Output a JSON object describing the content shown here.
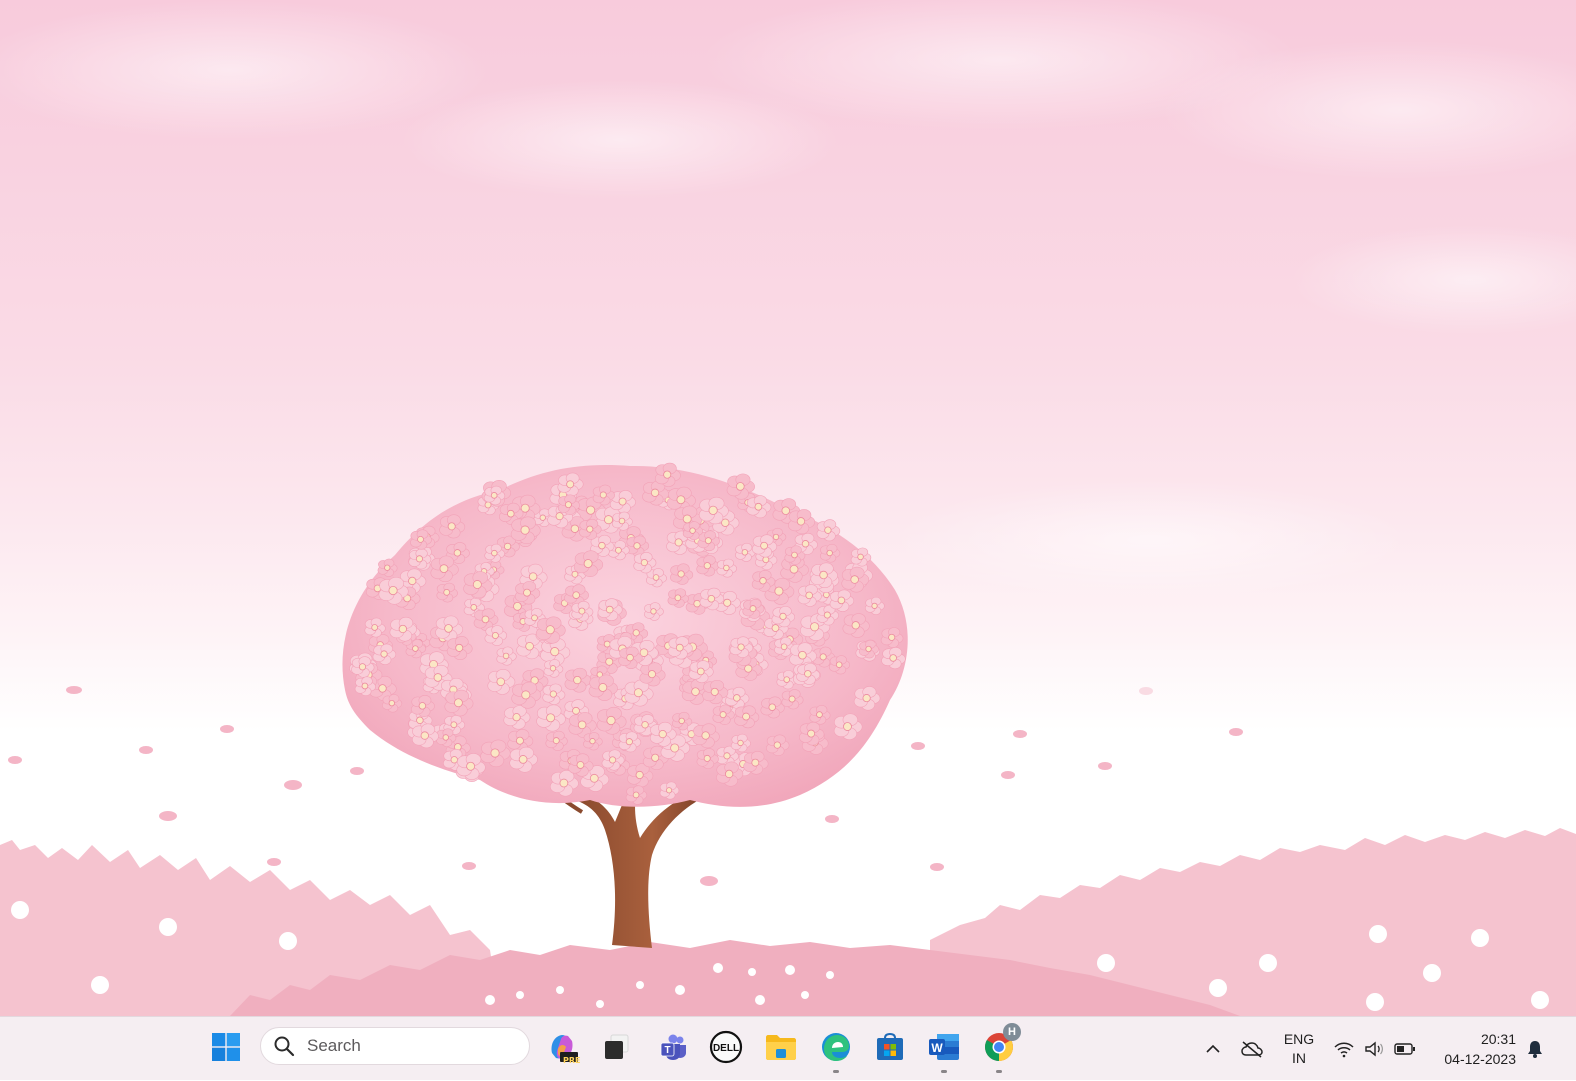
{
  "desktop": {
    "wallpaper": "cherry-blossom-tree",
    "colors": {
      "sky": "#f8cbdc",
      "hills": "#f4b8c6",
      "blossom": "#f6b3c6",
      "trunk": "#9a5536"
    }
  },
  "taskbar": {
    "background": "#f5eef2",
    "start_icon": "windows-logo-icon",
    "search": {
      "placeholder": "Search",
      "icon": "search-icon"
    },
    "apps": [
      {
        "name": "copilot-preview",
        "icon": "copilot-icon",
        "badge": "PRE",
        "running": false
      },
      {
        "name": "task-view",
        "icon": "task-view-icon",
        "running": false
      },
      {
        "name": "teams",
        "icon": "teams-icon",
        "running": false
      },
      {
        "name": "dell",
        "icon": "dell-icon",
        "label": "DELL",
        "running": false
      },
      {
        "name": "file-explorer",
        "icon": "folder-icon",
        "running": false
      },
      {
        "name": "edge",
        "icon": "edge-icon",
        "running": true
      },
      {
        "name": "microsoft-store",
        "icon": "store-icon",
        "running": false
      },
      {
        "name": "word",
        "icon": "word-icon",
        "letter": "W",
        "running": true
      },
      {
        "name": "chrome",
        "icon": "chrome-icon",
        "profile_badge": "H",
        "running": true
      }
    ],
    "tray": {
      "overflow_icon": "chevron-up-icon",
      "onedrive_icon": "cloud-offline-icon",
      "language_line1": "ENG",
      "language_line2": "IN",
      "wifi_icon": "wifi-icon",
      "volume_icon": "volume-icon",
      "battery_icon": "battery-icon",
      "time": "20:31",
      "date": "04-12-2023",
      "notification_icon": "bell-icon"
    }
  }
}
